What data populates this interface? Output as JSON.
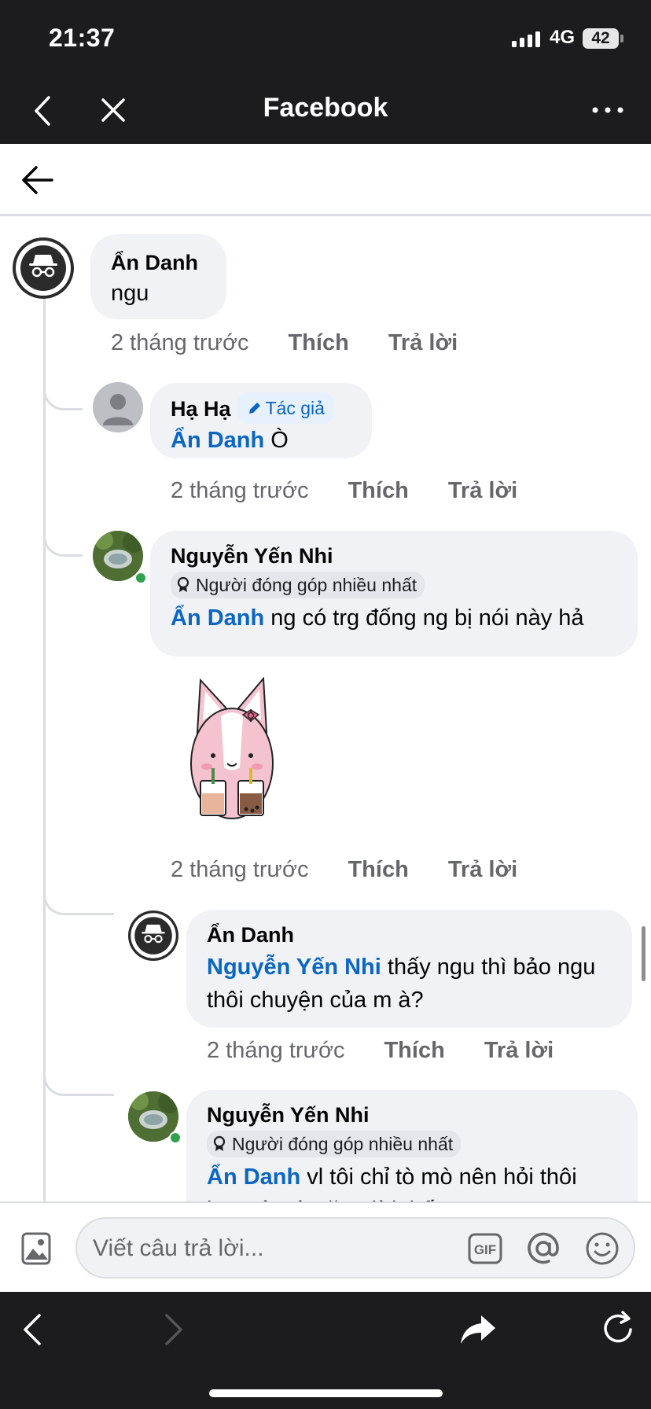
{
  "status_bar": {
    "time": "21:37",
    "network": "4G",
    "battery": "42"
  },
  "browser": {
    "title": "Facebook"
  },
  "comments": [
    {
      "name": "Ẩn Danh",
      "text": "ngu",
      "time": "2 tháng trước",
      "like": "Thích",
      "reply": "Trả lời"
    },
    {
      "name": "Hạ Hạ",
      "badge": "Tác giả",
      "mention": "Ẩn Danh",
      "text": " Ò",
      "time": "2 tháng trước",
      "like": "Thích",
      "reply": "Trả lời"
    },
    {
      "name": "Nguyễn Yến Nhi",
      "badge": "Người đóng góp nhiều nhất",
      "mention": "Ẩn Danh",
      "text": " ng có trg đống ng bị nói này hả",
      "time": "2 tháng trước",
      "like": "Thích",
      "reply": "Trả lời"
    },
    {
      "name": "Ẩn Danh",
      "mention": "Nguyễn Yến Nhi",
      "text": " thấy ngu thì bảo ngu thôi chuyện của m à?",
      "time": "2 tháng trước",
      "like": "Thích",
      "reply": "Trả lời"
    },
    {
      "name": "Nguyễn Yến Nhi",
      "badge": "Người đóng góp nhiều nhất",
      "mention": "Ẩn Danh",
      "text": " vl tôi chỉ tò mò nên hỏi thôi bạn gì mà nặng lời thế"
    }
  ],
  "reply_bar": {
    "placeholder": "Viết câu trả lời...",
    "gif_label": "GIF"
  },
  "icons": {
    "anonymous_avatar": "incognito-icon",
    "default_avatar": "person-icon",
    "badge_top": "award-icon",
    "badge_author": "pencil-icon"
  },
  "colors": {
    "mention": "#0a66c2",
    "online": "#31a24c",
    "bubble": "#f0f2f5"
  }
}
